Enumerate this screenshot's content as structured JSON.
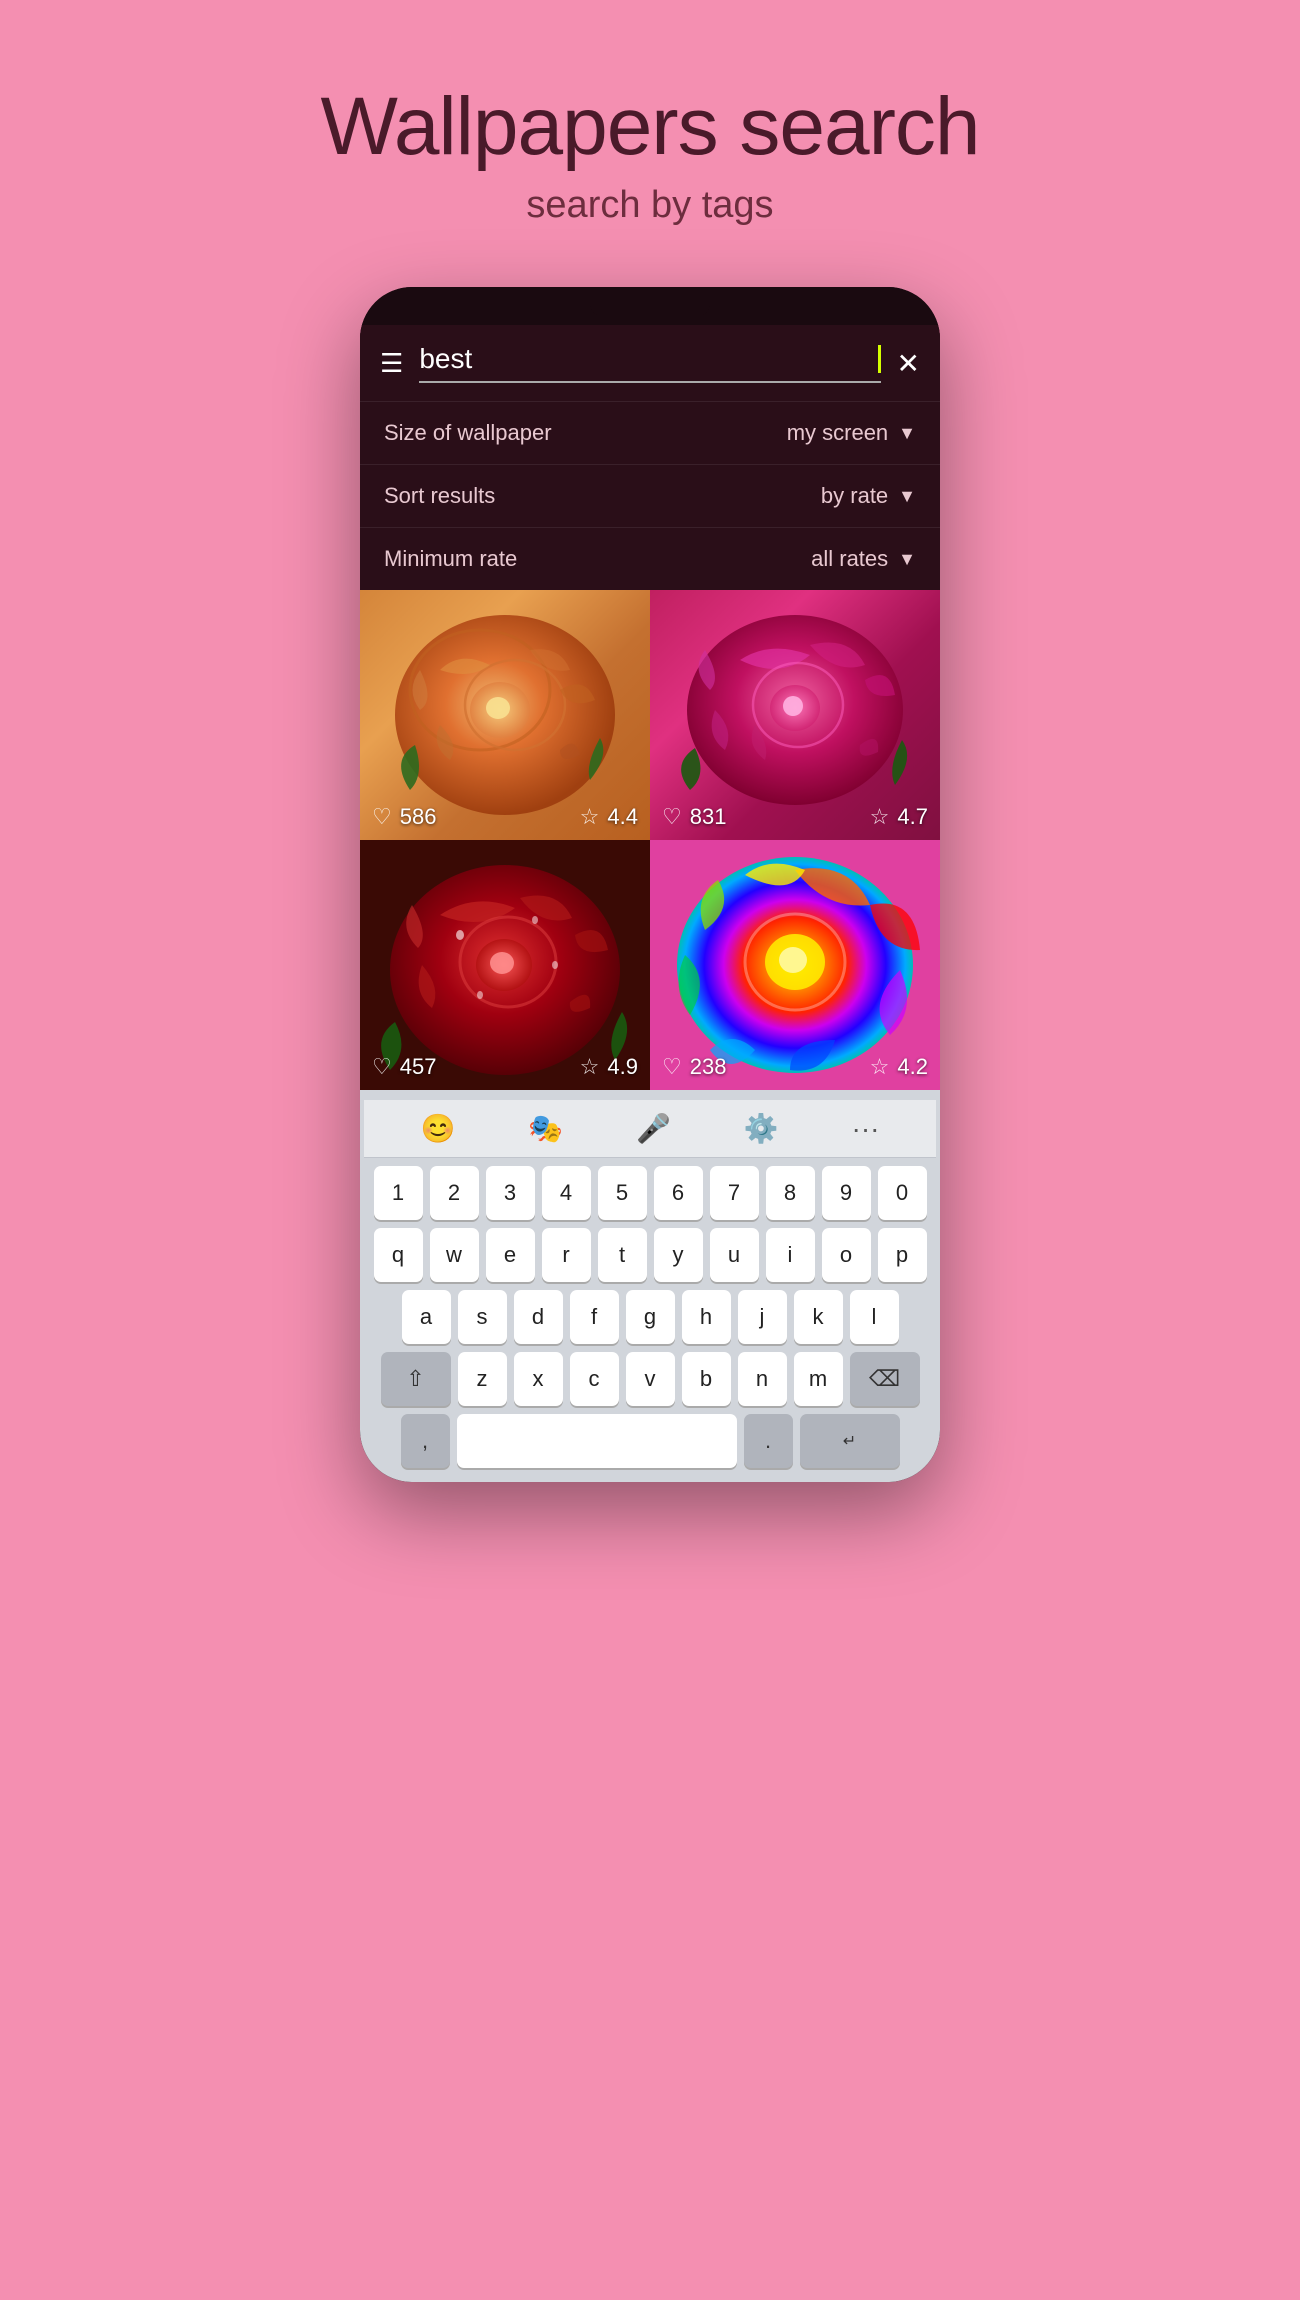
{
  "page": {
    "title": "Wallpapers search",
    "subtitle": "search by tags",
    "background_color": "#f48fb1"
  },
  "header": {
    "hamburger_label": "☰",
    "search_value": "best",
    "close_label": "✕"
  },
  "filters": {
    "size_label": "Size of wallpaper",
    "size_value": "my screen",
    "sort_label": "Sort results",
    "sort_value": "by rate",
    "min_rate_label": "Minimum rate",
    "min_rate_value": "all rates"
  },
  "images": [
    {
      "id": 1,
      "type": "rose-orange",
      "likes": "586",
      "rating": "4.4"
    },
    {
      "id": 2,
      "type": "rose-pink",
      "likes": "831",
      "rating": "4.7"
    },
    {
      "id": 3,
      "type": "rose-red",
      "likes": "457",
      "rating": "4.9"
    },
    {
      "id": 4,
      "type": "rose-rainbow",
      "likes": "238",
      "rating": "4.2"
    }
  ],
  "keyboard": {
    "toolbar_icons": [
      "😊",
      "🎭",
      "🎤",
      "⚙️",
      "···"
    ],
    "row_numbers": [
      "1",
      "2",
      "3",
      "4",
      "5",
      "6",
      "7",
      "8",
      "9",
      "0"
    ],
    "row1": [
      "q",
      "w",
      "e",
      "r",
      "t",
      "y",
      "u",
      "i",
      "o",
      "p"
    ],
    "row2": [
      "a",
      "s",
      "d",
      "f",
      "g",
      "h",
      "j",
      "k",
      "l"
    ],
    "row3": [
      "z",
      "x",
      "c",
      "v",
      "b",
      "n",
      "m"
    ],
    "shift_label": "⇧",
    "backspace_label": "⌫",
    "comma_label": ",",
    "space_label": " ",
    "period_label": ".",
    "enter_label": "↵"
  }
}
